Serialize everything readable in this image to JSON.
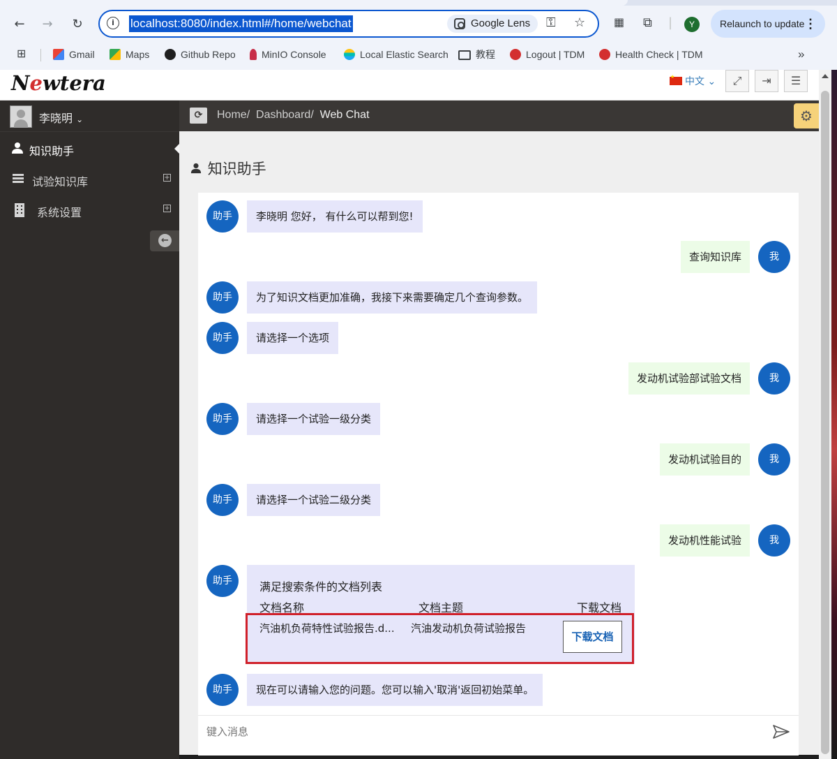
{
  "browser": {
    "url": "localhost:8080/index.html#/home/webchat",
    "lens_label": "Google Lens",
    "profile_initial": "Y",
    "relaunch_label": "Relaunch to update",
    "bookmarks": [
      {
        "label": "Gmail",
        "icon": "gmail-icon"
      },
      {
        "label": "Maps",
        "icon": "maps-icon"
      },
      {
        "label": "Github Repo",
        "icon": "github-icon"
      },
      {
        "label": "MinIO Console",
        "icon": "minio-icon"
      },
      {
        "label": "Local Elastic Search",
        "icon": "elastic-icon"
      },
      {
        "label": "教程",
        "icon": "folder-icon"
      },
      {
        "label": "Logout | TDM",
        "icon": "tdm-icon"
      },
      {
        "label": "Health Check | TDM",
        "icon": "tdm-icon"
      }
    ],
    "more_bookmarks": "»"
  },
  "app": {
    "logo_pre": "N",
    "logo_e": "e",
    "logo_post": "wtera",
    "language": "中文",
    "user_name": "李晓明"
  },
  "sidebar": {
    "items": [
      {
        "label": "知识助手",
        "icon": "user-icon",
        "active": true
      },
      {
        "label": "试验知识库",
        "icon": "database-icon",
        "expandable": true
      },
      {
        "label": "系统设置",
        "icon": "building-icon",
        "expandable": true
      }
    ]
  },
  "breadcrumb": {
    "home": "Home",
    "dashboard": "Dashboard",
    "current": "Web Chat",
    "sep": "/"
  },
  "page": {
    "title": "知识助手"
  },
  "chat": {
    "bot_label": "助手",
    "me_label": "我",
    "messages": [
      {
        "from": "bot",
        "text": "李晓明 您好， 有什么可以帮到您!"
      },
      {
        "from": "me",
        "text": "查询知识库"
      },
      {
        "from": "bot",
        "text": "为了知识文档更加准确，我接下来需要确定几个查询参数。"
      },
      {
        "from": "bot",
        "text": "请选择一个选项"
      },
      {
        "from": "me",
        "text": "发动机试验部试验文档"
      },
      {
        "from": "bot",
        "text": "请选择一个试验一级分类"
      },
      {
        "from": "me",
        "text": "发动机试验目的"
      },
      {
        "from": "bot",
        "text": "请选择一个试验二级分类"
      },
      {
        "from": "me",
        "text": "发动机性能试验"
      },
      {
        "from": "bot",
        "text": "现在可以请输入您的问题。您可以输入'取消'返回初始菜单。"
      }
    ],
    "doc_list": {
      "title": "满足搜索条件的文档列表",
      "headers": [
        "文档名称",
        "文档主题",
        "下载文档"
      ],
      "rows": [
        {
          "name": "汽油机负荷特性试验报告.d...",
          "topic": "汽油发动机负荷试验报告",
          "action": "下载文档"
        }
      ]
    },
    "input_placeholder": "键入消息"
  }
}
